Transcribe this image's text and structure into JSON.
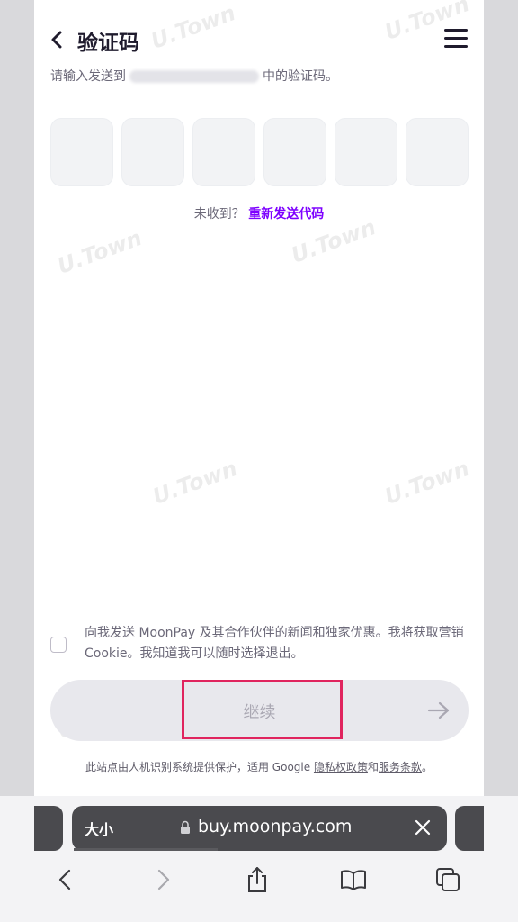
{
  "header": {
    "title": "验证码"
  },
  "subtitle": {
    "prefix": "请输入发送到",
    "suffix": "中的验证码。"
  },
  "otp": {
    "digit_count": 6
  },
  "resend": {
    "prompt": "未收到？",
    "link": "重新发送代码"
  },
  "consent": {
    "text": "向我发送 MoonPay 及其合作伙伴的新闻和独家优惠。我将获取营销 Cookie。我知道我可以随时选择退出。"
  },
  "continue_button": {
    "label": "继续"
  },
  "footer": {
    "prefix": "此站点由人机识别系统提供保护，适用 Google ",
    "privacy_link": "隐私权政策",
    "and": "和",
    "terms_link": "服务条款",
    "suffix": "。"
  },
  "browser": {
    "size_button": "大小",
    "url": "buy.moonpay.com"
  },
  "watermark": "U.Town",
  "colors": {
    "accent": "#7d00ff",
    "highlight": "#e0245e",
    "button_bg": "#e8e8ed",
    "otp_bg": "#f2f3f5"
  }
}
